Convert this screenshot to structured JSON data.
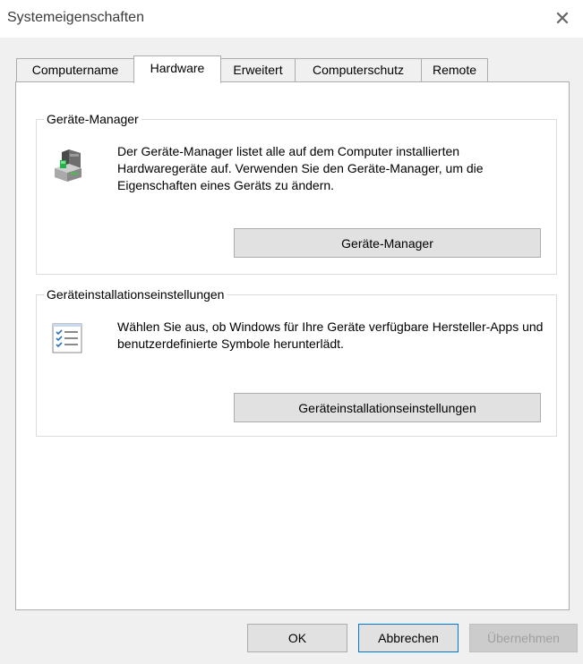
{
  "window": {
    "title": "Systemeigenschaften",
    "close_glyph": "✕"
  },
  "tabs": [
    {
      "label": "Computername",
      "active": false
    },
    {
      "label": "Hardware",
      "active": true
    },
    {
      "label": "Erweitert",
      "active": false
    },
    {
      "label": "Computerschutz",
      "active": false
    },
    {
      "label": "Remote",
      "active": false
    }
  ],
  "device_manager": {
    "title": "Geräte-Manager",
    "description": "Der Geräte-Manager listet alle auf dem Computer installierten Hardwaregeräte auf. Verwenden Sie den Geräte-Manager, um die Eigenschaften eines Geräts zu ändern.",
    "button_label": "Geräte-Manager",
    "icon": "device-manager-icon"
  },
  "device_installation": {
    "title": "Geräteinstallationseinstellungen",
    "description": "Wählen Sie aus, ob Windows für Ihre Geräte verfügbare Hersteller-Apps und benutzerdefinierte Symbole herunterlädt.",
    "button_label": "Geräteinstallationseinstellungen",
    "icon": "checklist-icon"
  },
  "footer": {
    "ok_label": "OK",
    "cancel_label": "Abbrechen",
    "apply_label": "Übernehmen",
    "apply_disabled": true
  },
  "colors": {
    "window_bg": "#f0f0f0",
    "panel_bg": "#ffffff",
    "button_bg": "#e1e1e1",
    "focus_border": "#0078d7",
    "disabled_text": "#a0a0a0"
  }
}
